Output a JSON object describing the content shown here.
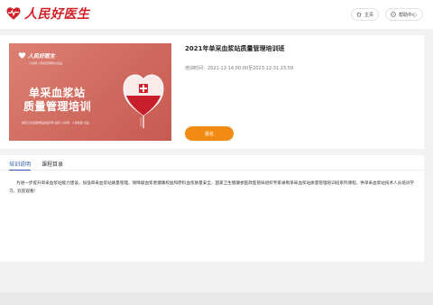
{
  "header": {
    "logo_text": "人民好医生",
    "logo_icon": "heart-pulse-icon",
    "home_label": "主页",
    "help_label": "帮助中心",
    "brand_color": "#d0202a"
  },
  "course": {
    "banner": {
      "logo_text": "人民好医生",
      "subtitle": "人民网·人民健康网联合出品",
      "title_line1": "单采血浆站",
      "title_line2": "质量管理培训",
      "footer": "国家卫生健康委医政医管局  指导    人民网 · 人民健康  出品"
    },
    "title": "2021年单采血浆站质量管理培训班",
    "time_label": "培训时间：",
    "time_value": "2021-12-14 00:00至2023-12-31 23:59",
    "enroll_label": "报名",
    "accent_color": "#f28b14"
  },
  "tabs": [
    {
      "label": "培训说明",
      "active": true
    },
    {
      "label": "课程目录",
      "active": false
    }
  ],
  "description": "为进一步提升单采血浆站能力建设，加强单采血浆站质量管理，保障献血浆者健康权益和原料血浆质量安全，国家卫生健康委医政医管局组织专家录制单采血浆站质量管理培训班系列课程，供单采血浆站技术人员培训学习，欢迎观看！"
}
